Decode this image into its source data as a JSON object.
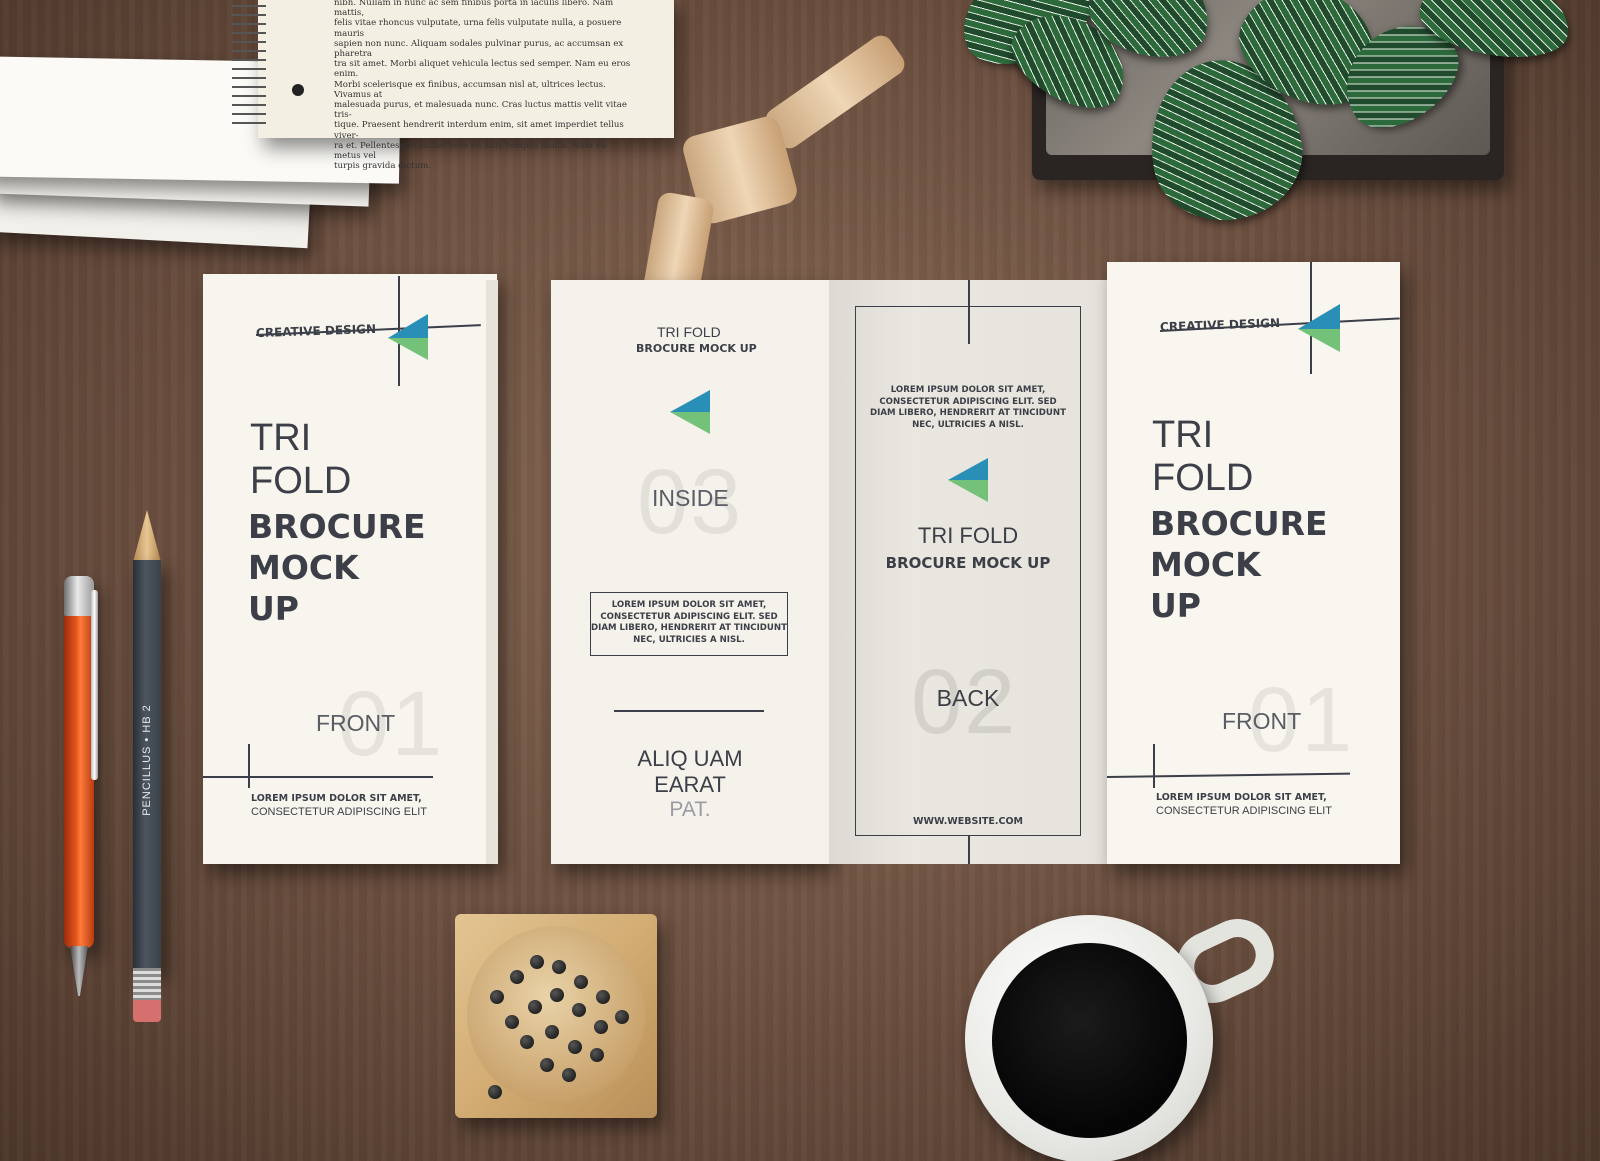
{
  "notepad": {
    "lines": [
      "nibh. Nullam in nunc ac sem finibus porta in iaculis libero. Nam mattis,",
      "felis vitae rhoncus vulputate, urna felis vulputate nulla, a posuere mauris",
      "sapien non nunc. Aliquam sodales pulvinar purus, ac accumsan ex pharetra",
      "tra sit amet. Morbi aliquet vehicula lectus sed semper. Nam eu eros enim.",
      "Morbi scelerisque ex finibus, accumsan nisl at, ultrices lectus. Vivamus at",
      "malesuada purus, et malesuada nunc. Cras luctus mattis velit vitae tris-",
      "tique. Praesent hendrerit interdum enim, sit amet imperdiet tellus viver-",
      "ra et. Pellentesque auctor eros eu ante tempus mollis. Nam eu metus vel",
      "turpis gravida dictum."
    ]
  },
  "front_left": {
    "tag": "CREATIVE DESIGN",
    "title_light_1": "TRI",
    "title_light_2": "FOLD",
    "title_bold_1": "BROCURE",
    "title_bold_2": "MOCK",
    "title_bold_3": "UP",
    "label": "FRONT",
    "number": "01",
    "footer_bold": "LOREM IPSUM DOLOR SIT AMET,",
    "footer_light": "CONSECTETUR ADIPISCING ELIT"
  },
  "inside": {
    "title_line_1": "TRI FOLD",
    "title_line_2": "BROCURE MOCK UP",
    "number": "03",
    "label": "INSIDE",
    "box_text": [
      "LOREM IPSUM DOLOR SIT AMET,",
      "CONSECTETUR ADIPISCING ELIT. SED",
      "DIAM LIBERO, HENDRERIT AT TINCIDUNT",
      "NEC, ULTRICIES A NISL."
    ],
    "bottom_line_1": "ALIQ UAM",
    "bottom_line_2": "EARAT",
    "bottom_line_3": "PAT."
  },
  "back": {
    "text": [
      "LOREM IPSUM DOLOR SIT AMET,",
      "CONSECTETUR ADIPISCING ELIT. SED",
      "DIAM LIBERO, HENDRERIT AT TINCIDUNT",
      "NEC, ULTRICIES A NISL."
    ],
    "title_line_1": "TRI FOLD",
    "title_line_2": "BROCURE MOCK UP",
    "number": "02",
    "label": "BACK",
    "website": "WWW.WEBSITE.COM"
  },
  "front_right": {
    "tag": "CREATIVE DESIGN",
    "title_light_1": "TRI",
    "title_light_2": "FOLD",
    "title_bold_1": "BROCURE",
    "title_bold_2": "MOCK",
    "title_bold_3": "UP",
    "label": "FRONT",
    "number": "01",
    "footer_bold": "LOREM IPSUM DOLOR SIT AMET,",
    "footer_light": "CONSECTETUR ADIPISCING ELIT"
  },
  "pencil": {
    "label": "PENCILLUS  •  HB 2"
  },
  "colors": {
    "logo_blue": "#2a8fb6",
    "logo_green": "#74c27a",
    "ink": "#3c3f48",
    "pen_orange": "#e2551c"
  }
}
